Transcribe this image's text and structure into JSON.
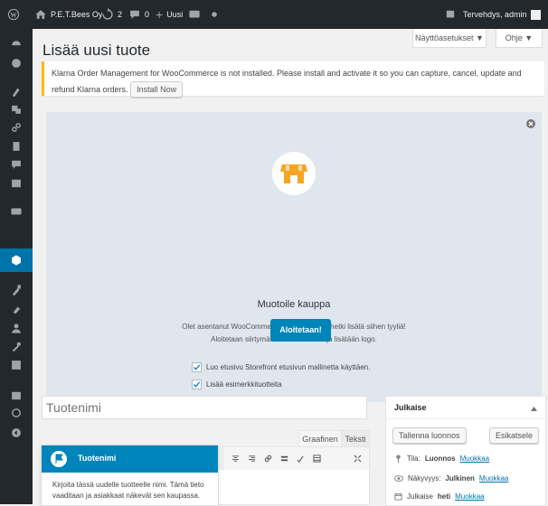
{
  "admin_bar": {
    "site_name": "P.E.T.Bees Oy",
    "updates_count": "2",
    "comments_count": "0",
    "new_label": "Uusi",
    "greeting": "Tervehdys, admin"
  },
  "screen_options": {
    "screen_options_label": "Näyttöasetukset ▼",
    "help_label": "Ohje ▼"
  },
  "page": {
    "title": "Lisää uusi tuote"
  },
  "notice": {
    "text": "Klarna Order Management for WooCommerce is not installed. Please install and activate it so you can capture, cancel, update and refund Klarna orders.",
    "button_label": "Install Now"
  },
  "wizard": {
    "title": "Muotoile kauppa",
    "description_line1": "Olet asentanut WooCommercen, nyt on oikea hetki lisätä siihen tyyliä!",
    "description_line2": "Aloitetaan siirtymällä Mukauttimeen ja lisätään logo.",
    "option1": "Luo etusivu Storefront etusivun mallinetta käyttäen.",
    "option2": "Lisää esimerkkituotteita",
    "start_button": "Aloitetaan!"
  },
  "editor": {
    "title_placeholder": "Tuotenimi",
    "tab_visual": "Graafinen",
    "tab_text": "Teksti"
  },
  "pointer": {
    "title": "Tuotenimi",
    "text": "Kirjoita tässä uudelle tuotteelle nimi. Tämä tieto vaaditaan ja asiakkaat näkevät sen kaupassa."
  },
  "publish": {
    "heading": "Julkaise",
    "save_draft": "Tallenna luonnos",
    "preview": "Esikatsele",
    "status_label": "Tila:",
    "status_value": "Luonnos",
    "visibility_label": "Näkyvyys:",
    "visibility_value": "Julkinen",
    "publish_label": "Julkaise",
    "publish_value": "heti",
    "edit_link": "Muokkaa"
  }
}
